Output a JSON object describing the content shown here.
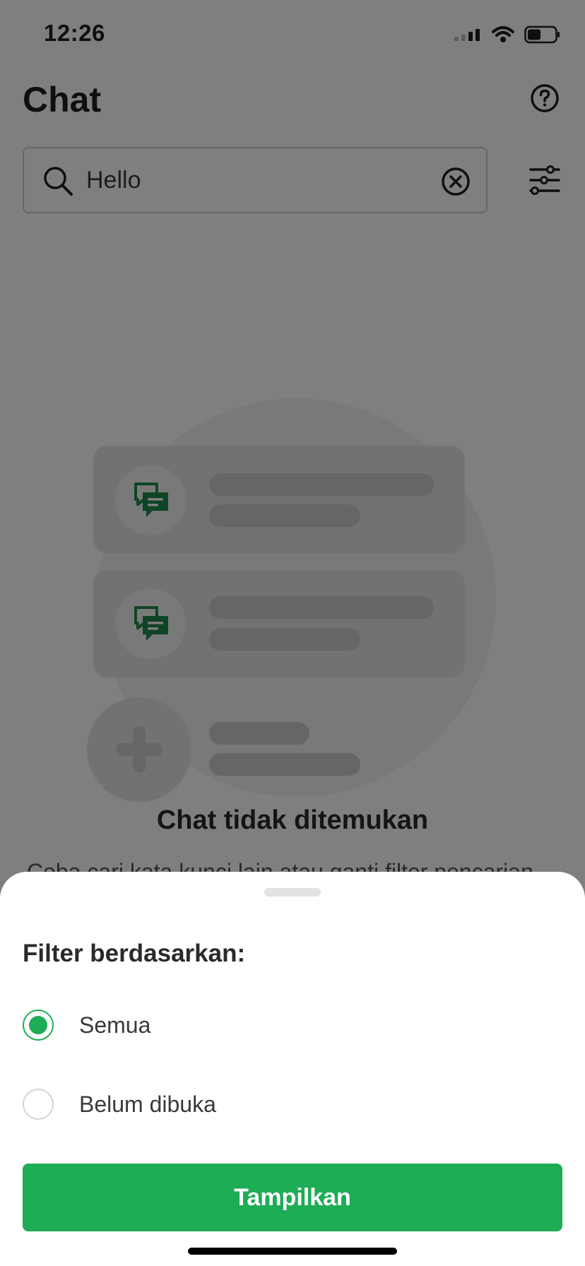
{
  "status_bar": {
    "time": "12:26"
  },
  "header": {
    "title": "Chat"
  },
  "search": {
    "value": "Hello"
  },
  "empty_state": {
    "title": "Chat tidak ditemukan",
    "description": "Coba cari kata kunci lain atau ganti filter pencarian"
  },
  "filter_sheet": {
    "title": "Filter berdasarkan:",
    "options": [
      {
        "label": "Semua",
        "selected": true
      },
      {
        "label": "Belum dibuka",
        "selected": false
      }
    ],
    "submit_label": "Tampilkan"
  },
  "colors": {
    "accent": "#1eac55",
    "chat_icon": "#1e8a4a",
    "overlay": "rgba(0,0,0,0.5)"
  }
}
